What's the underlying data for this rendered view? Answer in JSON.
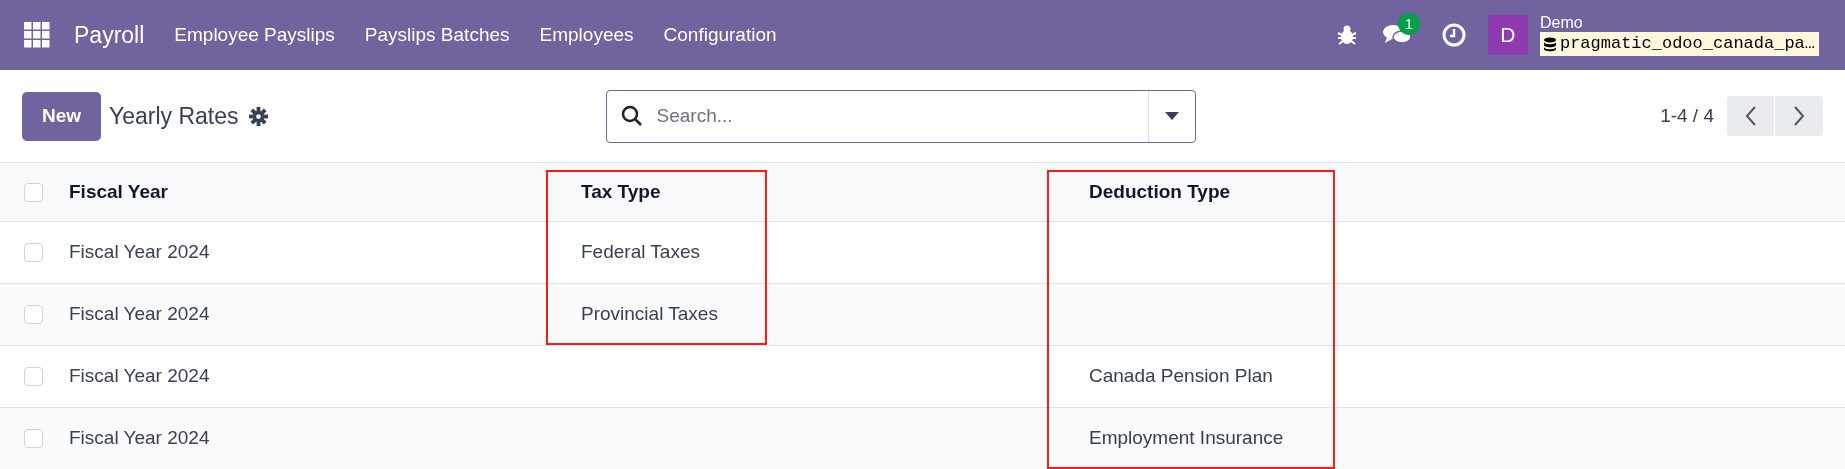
{
  "navbar": {
    "app_name": "Payroll",
    "menu": [
      "Employee Payslips",
      "Payslips Batches",
      "Employees",
      "Configuration"
    ],
    "messages_badge": "1",
    "user": {
      "initial": "D",
      "name": "Demo",
      "database": "pragmatic_odoo_canada_pa…"
    }
  },
  "control_panel": {
    "new_button": "New",
    "title": "Yearly Rates",
    "search": {
      "placeholder": "Search..."
    },
    "pager": "1-4 / 4"
  },
  "table": {
    "all_checked": false,
    "columns": [
      {
        "label": "Fiscal Year",
        "highlighted": false
      },
      {
        "label": "Tax Type",
        "highlighted": true
      },
      {
        "label": "Deduction Type",
        "highlighted": true
      }
    ],
    "rows": [
      {
        "checked": false,
        "cells": [
          "Fiscal Year 2024",
          "Federal Taxes",
          ""
        ]
      },
      {
        "checked": false,
        "cells": [
          "Fiscal Year 2024",
          "Provincial Taxes",
          ""
        ]
      },
      {
        "checked": false,
        "cells": [
          "Fiscal Year 2024",
          "",
          "Canada Pension Plan"
        ]
      },
      {
        "checked": false,
        "cells": [
          "Fiscal Year 2024",
          "",
          "Employment Insurance"
        ]
      }
    ]
  }
}
